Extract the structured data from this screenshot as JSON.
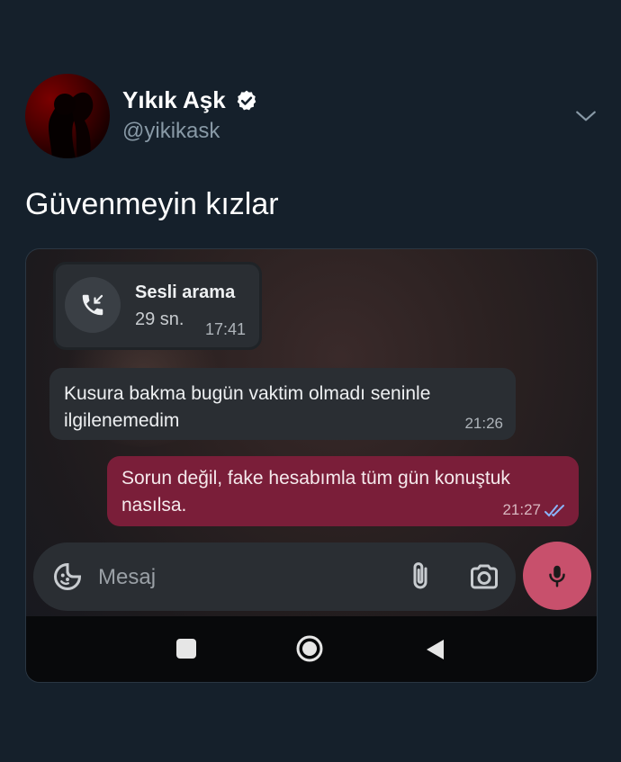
{
  "tweet": {
    "author_name": "Yıkık Aşk",
    "handle": "@yikikask",
    "text": "Güvenmeyin kızlar"
  },
  "chat": {
    "call": {
      "title": "Sesli arama",
      "duration": "29 sn.",
      "time": "17:41"
    },
    "messages": [
      {
        "direction": "incoming",
        "text": "Kusura bakma bugün vaktim olmadı seninle ilgilenemedim",
        "time": "21:26"
      },
      {
        "direction": "outgoing",
        "text": "Sorun değil, fake hesabımla tüm gün konuştuk nasılsa.",
        "time": "21:27",
        "read": true
      }
    ],
    "input": {
      "placeholder": "Mesaj",
      "value": ""
    }
  },
  "colors": {
    "background": "#15202b",
    "outgoing_bubble": "#7a1e39",
    "incoming_bubble": "#2a2e33",
    "mic_button": "#c8506c",
    "read_ticks": "#8ab4f8"
  },
  "icons": {
    "verified": "verified-badge-icon",
    "more": "chevron-down-icon",
    "call": "incoming-call-icon",
    "emoji": "sticker-emoji-icon",
    "attach": "paperclip-icon",
    "camera": "camera-icon",
    "mic": "microphone-icon",
    "ticks": "double-check-icon",
    "nav_recents": "square-icon",
    "nav_home": "circle-home-icon",
    "nav_back": "triangle-back-icon"
  }
}
